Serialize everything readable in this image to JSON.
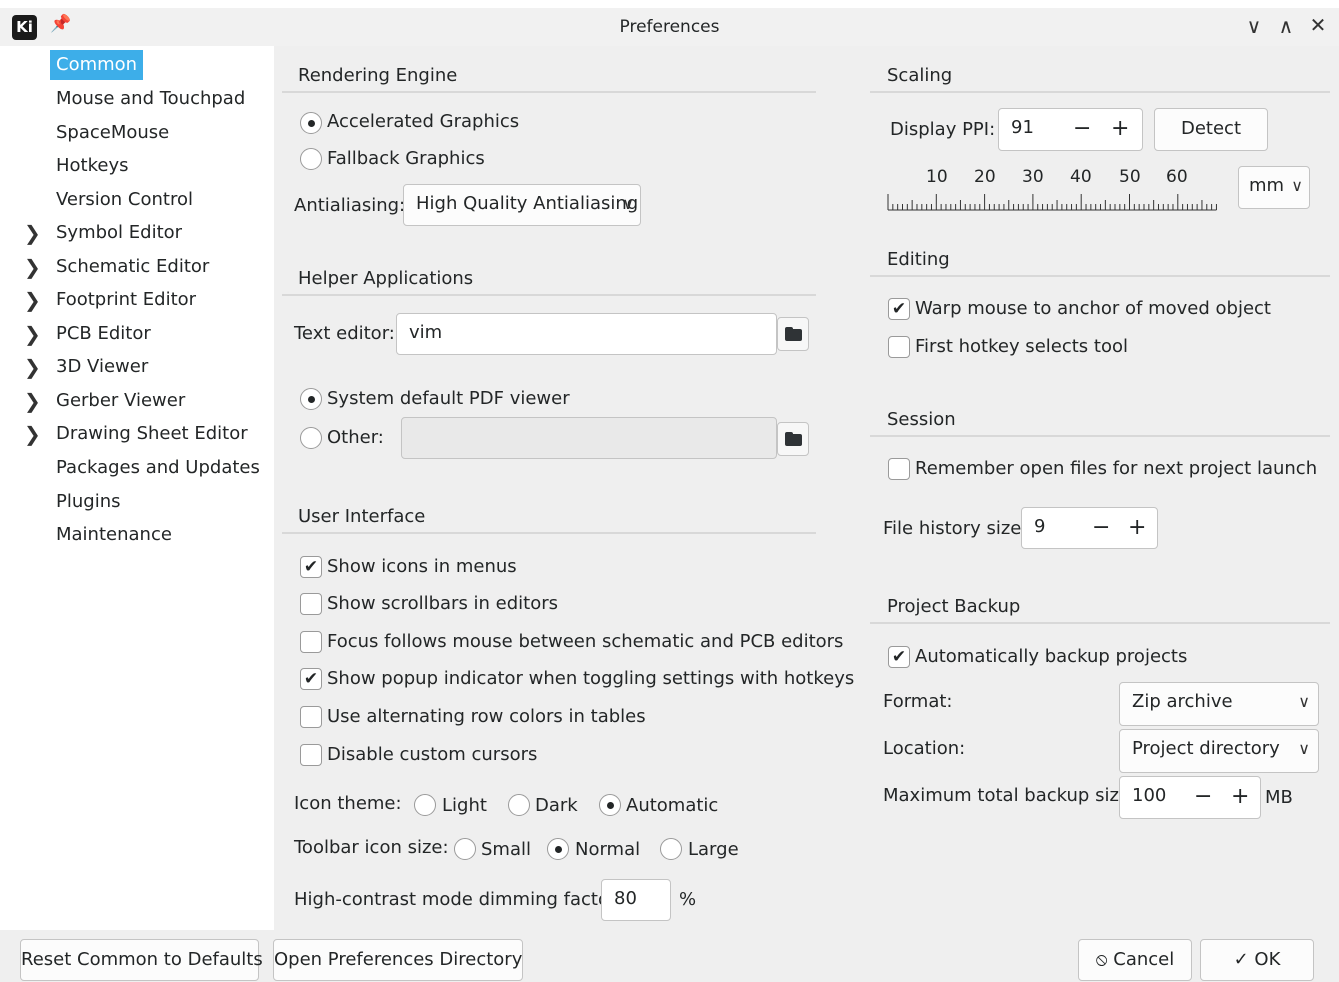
{
  "window": {
    "logo": "Ki",
    "pin_icon": "pin-icon",
    "title": "Preferences",
    "controls": [
      "chevron-down-icon",
      "chevron-up-icon",
      "close-icon"
    ]
  },
  "sidebar": {
    "items": [
      {
        "label": "Common",
        "selected": true,
        "expandable": false
      },
      {
        "label": "Mouse and Touchpad",
        "expandable": false
      },
      {
        "label": "SpaceMouse",
        "expandable": false
      },
      {
        "label": "Hotkeys",
        "expandable": false
      },
      {
        "label": "Version Control",
        "expandable": false
      },
      {
        "label": "Symbol Editor",
        "expandable": true
      },
      {
        "label": "Schematic Editor",
        "expandable": true
      },
      {
        "label": "Footprint Editor",
        "expandable": true
      },
      {
        "label": "PCB Editor",
        "expandable": true
      },
      {
        "label": "3D Viewer",
        "expandable": true
      },
      {
        "label": "Gerber Viewer",
        "expandable": true
      },
      {
        "label": "Drawing Sheet Editor",
        "expandable": true
      },
      {
        "label": "Packages and Updates",
        "expandable": false
      },
      {
        "label": "Plugins",
        "expandable": false
      },
      {
        "label": "Maintenance",
        "expandable": false
      }
    ],
    "expand_glyph": "❯"
  },
  "rendering": {
    "title": "Rendering Engine",
    "accelerated": "Accelerated Graphics",
    "fallback": "Fallback Graphics",
    "selected": "accelerated",
    "antialiasing_label": "Antialiasing:",
    "antialiasing_value": "High Quality Antialiasing"
  },
  "helpers": {
    "title": "Helper Applications",
    "text_editor_label": "Text editor:",
    "text_editor_value": "vim",
    "pdf_default": "System default PDF viewer",
    "pdf_other": "Other:",
    "pdf_other_value": "",
    "pdf_selected": "default"
  },
  "ui": {
    "title": "User Interface",
    "options": [
      {
        "label": "Show icons in menus",
        "checked": true
      },
      {
        "label": "Show scrollbars in editors",
        "checked": false
      },
      {
        "label": "Focus follows mouse between schematic and PCB editors",
        "checked": false
      },
      {
        "label": "Show popup indicator when toggling settings with hotkeys",
        "checked": true
      },
      {
        "label": "Use alternating row colors in tables",
        "checked": false
      },
      {
        "label": "Disable custom cursors",
        "checked": false
      }
    ],
    "icon_theme_label": "Icon theme:",
    "icon_theme": {
      "light": "Light",
      "dark": "Dark",
      "automatic": "Automatic",
      "selected": "automatic"
    },
    "toolbar_size_label": "Toolbar icon size:",
    "toolbar_size": {
      "small": "Small",
      "normal": "Normal",
      "large": "Large",
      "selected": "normal"
    },
    "dimming_label": "High-contrast mode dimming factor:",
    "dimming_value": "80",
    "dimming_unit": "%"
  },
  "scaling": {
    "title": "Scaling",
    "ppi_label": "Display PPI:",
    "ppi_value": "91",
    "minus": "−",
    "plus": "+",
    "detect": "Detect",
    "ruler_labels": [
      "10",
      "20",
      "30",
      "40",
      "50",
      "60"
    ],
    "unit": "mm"
  },
  "editing": {
    "title": "Editing",
    "options": [
      {
        "label": "Warp mouse to anchor of moved object",
        "checked": true
      },
      {
        "label": "First hotkey selects tool",
        "checked": false
      }
    ]
  },
  "session": {
    "title": "Session",
    "remember_label": "Remember open files for next project launch",
    "remember_checked": false,
    "history_label": "File history size:",
    "history_value": "9"
  },
  "backup": {
    "title": "Project Backup",
    "auto_label": "Automatically backup projects",
    "auto_checked": true,
    "format_label": "Format:",
    "format_value": "Zip archive",
    "location_label": "Location:",
    "location_value": "Project directory",
    "max_label": "Maximum total backup size:",
    "max_value": "100",
    "max_unit": "MB"
  },
  "footer": {
    "reset": "Reset Common to Defaults",
    "open_dir": "Open Preferences Directory",
    "cancel": "Cancel",
    "cancel_icon": "⦸",
    "ok": "OK",
    "ok_icon": "✓"
  },
  "colors": {
    "accent": "#3daee9",
    "panel": "#efefef",
    "text": "#232627"
  }
}
